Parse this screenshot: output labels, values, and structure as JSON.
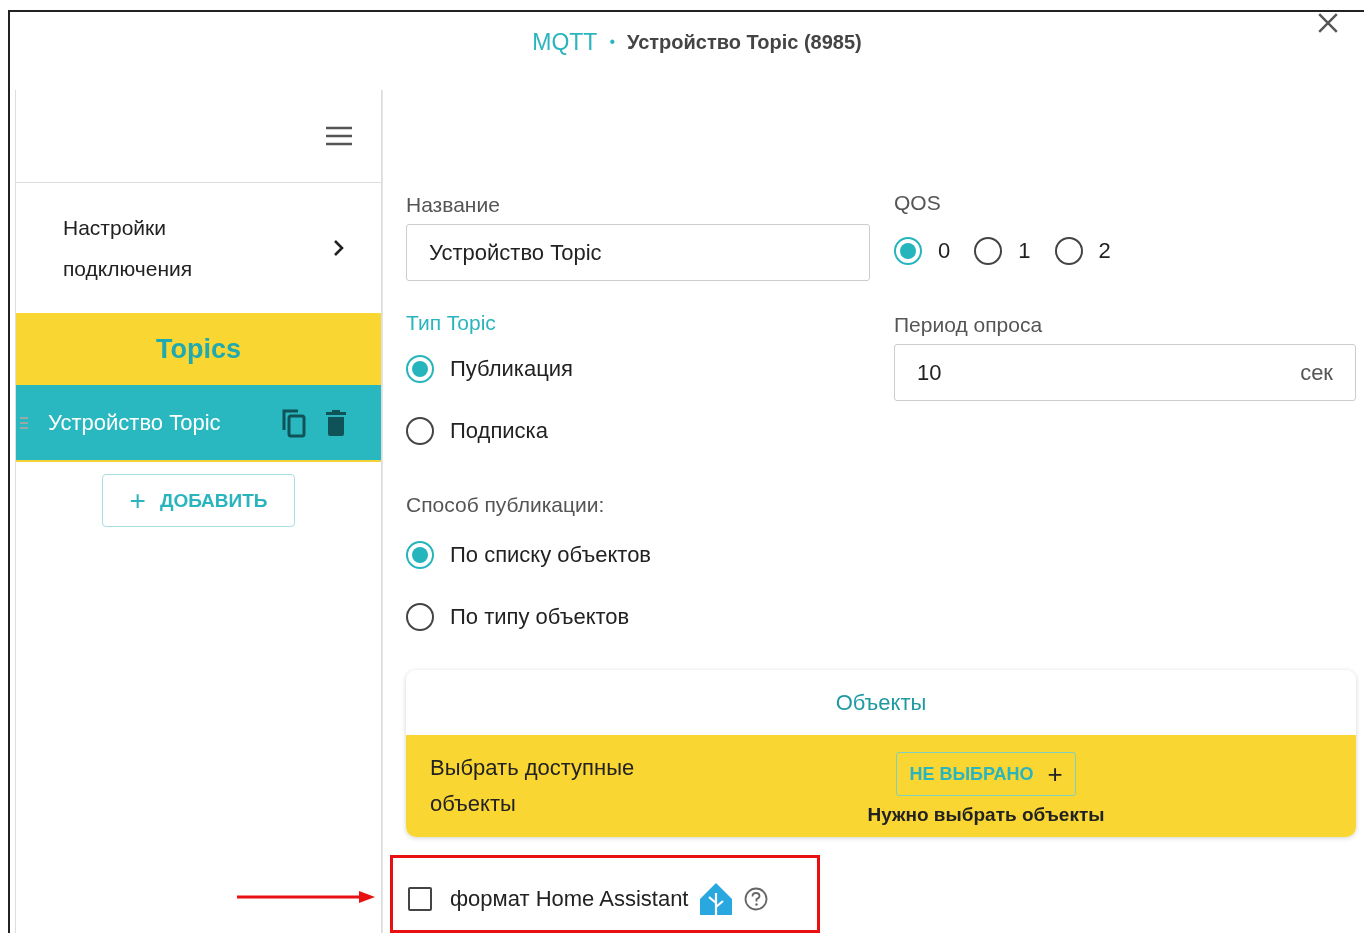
{
  "header": {
    "app": "MQTT",
    "separator": "•",
    "title": "Устройство Topic (8985)"
  },
  "sidebar": {
    "settings_link": "Настройки подключения",
    "section": "Topics",
    "topics": [
      {
        "name": "Устройство Topic",
        "selected": true
      }
    ],
    "add_button": {
      "icon": "+",
      "label": "ДОБАВИТЬ"
    }
  },
  "form": {
    "name": {
      "label": "Название",
      "value": "Устройство Topic"
    },
    "qos": {
      "label": "QOS",
      "options": [
        {
          "label": "0",
          "selected": true
        },
        {
          "label": "1",
          "selected": false
        },
        {
          "label": "2",
          "selected": false
        }
      ]
    },
    "topic_type": {
      "label": "Тип Topic",
      "options": [
        {
          "label": "Публикация",
          "selected": true
        },
        {
          "label": "Подписка",
          "selected": false
        }
      ]
    },
    "poll_period": {
      "label": "Период опроса",
      "value": "10",
      "unit": "сек"
    },
    "publish_method": {
      "label": "Способ публикации:",
      "options": [
        {
          "label": "По списку объектов",
          "selected": true
        },
        {
          "label": "По типу объектов",
          "selected": false
        }
      ]
    },
    "objects": {
      "title": "Объекты",
      "description": "Выбрать доступные объекты",
      "button": "НЕ ВЫБРАНО",
      "button_icon": "+",
      "hint": "Нужно выбрать объекты"
    },
    "ha_format": {
      "label": "формат Home Assistant",
      "checked": false
    }
  }
}
